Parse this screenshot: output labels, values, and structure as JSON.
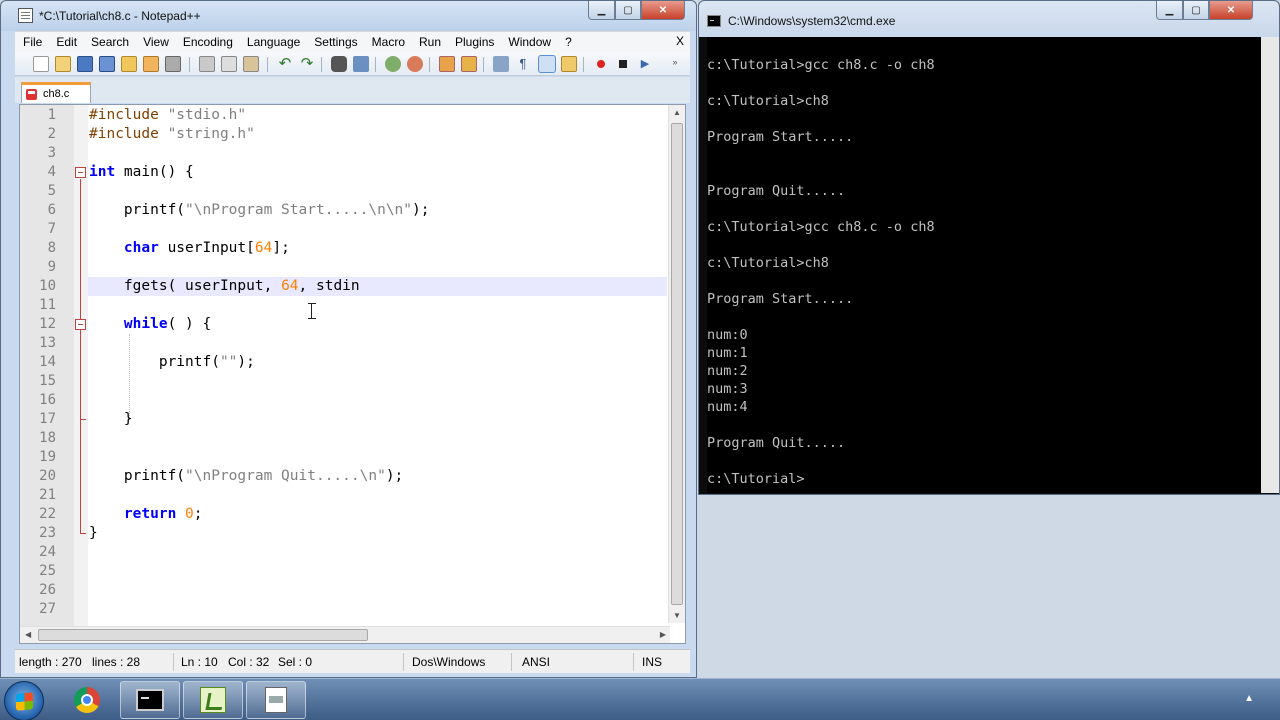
{
  "notepad": {
    "title": "*C:\\Tutorial\\ch8.c - Notepad++",
    "menu": [
      "File",
      "Edit",
      "Search",
      "View",
      "Encoding",
      "Language",
      "Settings",
      "Macro",
      "Run",
      "Plugins",
      "Window",
      "?"
    ],
    "menu_close": "X",
    "tab_label": "ch8.c",
    "line_numbers": [
      "1",
      "2",
      "3",
      "4",
      "5",
      "6",
      "7",
      "8",
      "9",
      "10",
      "11",
      "12",
      "13",
      "14",
      "15",
      "16",
      "17",
      "18",
      "19",
      "20",
      "21",
      "22",
      "23",
      "24",
      "25",
      "26",
      "27"
    ],
    "code": {
      "l1a": "#include ",
      "l1b": "\"stdio.h\"",
      "l2a": "#include ",
      "l2b": "\"string.h\"",
      "l4a": "int",
      "l4b": " main() {",
      "l6a": "    printf(",
      "l6b": "\"\\nProgram Start.....\\n\\n\"",
      "l6c": ");",
      "l8a": "    ",
      "l8b": "char",
      "l8c": " userInput[",
      "l8d": "64",
      "l8e": "];",
      "l10a": "    fgets( userInput, ",
      "l10b": "64",
      "l10c": ", stdin",
      "l12a": "    ",
      "l12b": "while",
      "l12c": "( ) {",
      "l14a": "        printf(",
      "l14b": "\"\"",
      "l14c": ");",
      "l17": "    }",
      "l20a": "    printf(",
      "l20b": "\"\\nProgram Quit.....\\n\"",
      "l20c": ");",
      "l22a": "    ",
      "l22b": "return",
      "l22c": " ",
      "l22d": "0",
      "l22e": ";",
      "l23": "}"
    },
    "status": {
      "length": "length : 270",
      "lines": "lines : 28",
      "ln": "Ln : 10",
      "col": "Col : 32",
      "sel": "Sel : 0",
      "eol": "Dos\\Windows",
      "encoding": "ANSI",
      "mode": "INS"
    }
  },
  "cmd": {
    "title": "C:\\Windows\\system32\\cmd.exe",
    "lines": [
      "c:\\Tutorial>gcc ch8.c -o ch8",
      "c:\\Tutorial>ch8",
      "Program Start.....",
      "Program Quit.....",
      "c:\\Tutorial>gcc ch8.c -o ch8",
      "c:\\Tutorial>ch8",
      "Program Start.....",
      "num:0",
      "num:1",
      "num:2",
      "num:3",
      "num:4",
      "Program Quit.....",
      "c:\\Tutorial>"
    ]
  },
  "taskbar": {
    "items": [
      "start-button",
      "chrome-icon",
      "cmd-icon",
      "notepadpp-icon",
      "document-icon"
    ]
  },
  "colors": {
    "keyword": "#0000ff",
    "string": "#808080",
    "number": "#ff8000",
    "preprocessor": "#804000",
    "current_line": "#e8e8ff",
    "fold": "#c24040"
  }
}
